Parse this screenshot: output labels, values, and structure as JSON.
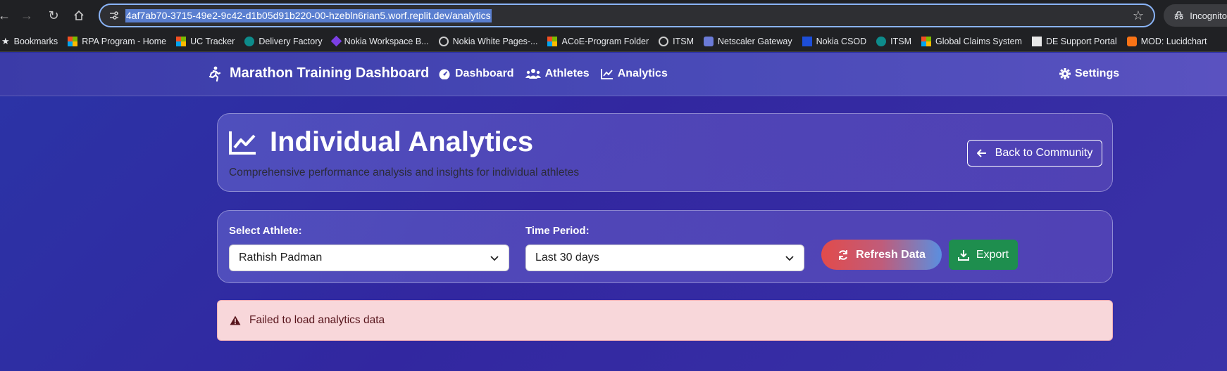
{
  "browser": {
    "url": "4af7ab70-3715-49e2-9c42-d1b05d91b220-00-hzebln6rian5.worf.replit.dev/analytics",
    "incognito_label": "Incognito",
    "bookmarks": [
      {
        "label": "Bookmarks",
        "icon": "star-icon"
      },
      {
        "label": "RPA Program - Home",
        "icon": "microsoft-icon"
      },
      {
        "label": "UC Tracker",
        "icon": "microsoft-icon"
      },
      {
        "label": "Delivery Factory",
        "icon": "servicenow-icon"
      },
      {
        "label": "Nokia Workspace B...",
        "icon": "nokia-icon"
      },
      {
        "label": "Nokia White Pages-...",
        "icon": "globe-icon"
      },
      {
        "label": "ACoE-Program Folder",
        "icon": "microsoft-icon"
      },
      {
        "label": "ITSM",
        "icon": "globe-icon"
      },
      {
        "label": "Netscaler Gateway",
        "icon": "lock-icon"
      },
      {
        "label": "Nokia CSOD",
        "icon": "nokia-n-icon"
      },
      {
        "label": "ITSM",
        "icon": "servicenow-icon"
      },
      {
        "label": "Global Claims System",
        "icon": "microsoft-icon"
      },
      {
        "label": "DE Support Portal",
        "icon": "document-icon"
      },
      {
        "label": "MOD: Lucidchart",
        "icon": "lucidchart-icon"
      }
    ]
  },
  "app": {
    "brand": "Marathon Training Dashboard",
    "nav": {
      "dashboard": "Dashboard",
      "athletes": "Athletes",
      "analytics": "Analytics",
      "settings": "Settings"
    },
    "hero": {
      "title": "Individual Analytics",
      "subtitle": "Comprehensive performance analysis and insights for individual athletes",
      "back_label": "Back to Community"
    },
    "filters": {
      "athlete_label": "Select Athlete:",
      "athlete_value": "Rathish Padman",
      "period_label": "Time Period:",
      "period_value": "Last 30 days",
      "refresh_label": "Refresh Data",
      "export_label": "Export"
    },
    "alert": {
      "message": "Failed to load analytics data"
    }
  }
}
